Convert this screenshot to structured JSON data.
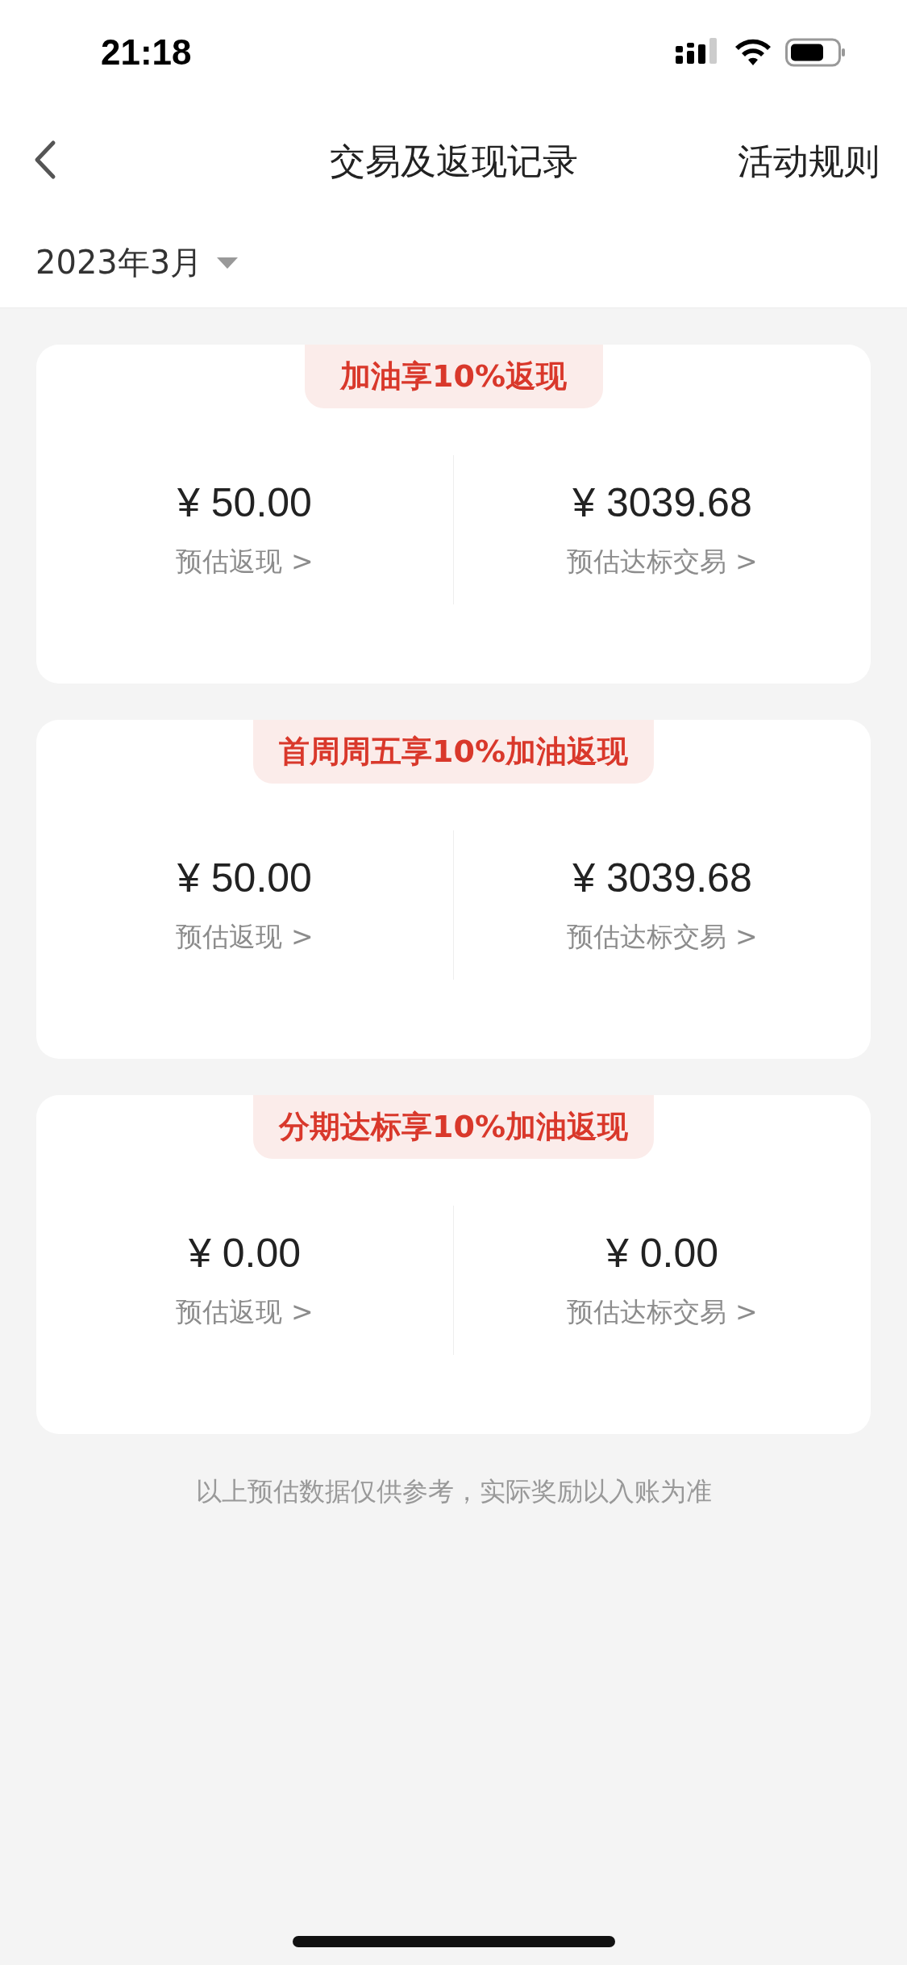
{
  "status_bar": {
    "time": "21:18"
  },
  "nav": {
    "title": "交易及返现记录",
    "action": "活动规则"
  },
  "month_picker": {
    "label": "2023年3月"
  },
  "cards": [
    {
      "badge": "加油享10%返现",
      "stats": [
        {
          "amount": "¥ 50.00",
          "label": "预估返现 >"
        },
        {
          "amount": "¥ 3039.68",
          "label": "预估达标交易 >"
        }
      ]
    },
    {
      "badge": "首周周五享10%加油返现",
      "stats": [
        {
          "amount": "¥ 50.00",
          "label": "预估返现 >"
        },
        {
          "amount": "¥ 3039.68",
          "label": "预估达标交易 >"
        }
      ]
    },
    {
      "badge": "分期达标享10%加油返现",
      "stats": [
        {
          "amount": "¥ 0.00",
          "label": "预估返现 >"
        },
        {
          "amount": "¥ 0.00",
          "label": "预估达标交易 >"
        }
      ]
    }
  ],
  "footer_note": "以上预估数据仅供参考，实际奖励以入账为准"
}
